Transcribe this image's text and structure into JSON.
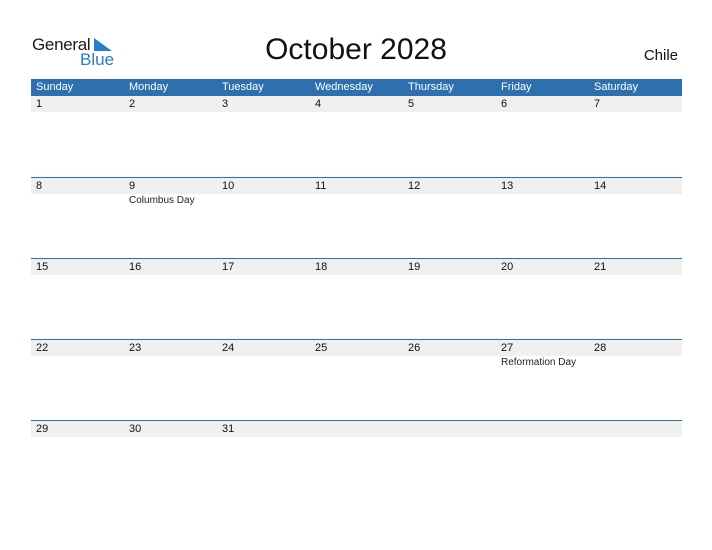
{
  "logo": {
    "line1": "General",
    "line2": "Blue",
    "icon": "triangle-flag-icon"
  },
  "title": "October 2028",
  "country": "Chile",
  "colors": {
    "header_bg": "#2e6fb0",
    "row_bg": "#f0f0f0",
    "accent": "#2a7ec8"
  },
  "weekdays": [
    "Sunday",
    "Monday",
    "Tuesday",
    "Wednesday",
    "Thursday",
    "Friday",
    "Saturday"
  ],
  "weeks": [
    {
      "days": [
        "1",
        "2",
        "3",
        "4",
        "5",
        "6",
        "7"
      ],
      "events": [
        "",
        "",
        "",
        "",
        "",
        "",
        ""
      ]
    },
    {
      "days": [
        "8",
        "9",
        "10",
        "11",
        "12",
        "13",
        "14"
      ],
      "events": [
        "",
        "Columbus Day",
        "",
        "",
        "",
        "",
        ""
      ]
    },
    {
      "days": [
        "15",
        "16",
        "17",
        "18",
        "19",
        "20",
        "21"
      ],
      "events": [
        "",
        "",
        "",
        "",
        "",
        "",
        ""
      ]
    },
    {
      "days": [
        "22",
        "23",
        "24",
        "25",
        "26",
        "27",
        "28"
      ],
      "events": [
        "",
        "",
        "",
        "",
        "",
        "Reformation Day",
        ""
      ]
    },
    {
      "days": [
        "29",
        "30",
        "31",
        "",
        "",
        "",
        ""
      ],
      "events": [
        "",
        "",
        "",
        "",
        "",
        "",
        ""
      ]
    }
  ]
}
